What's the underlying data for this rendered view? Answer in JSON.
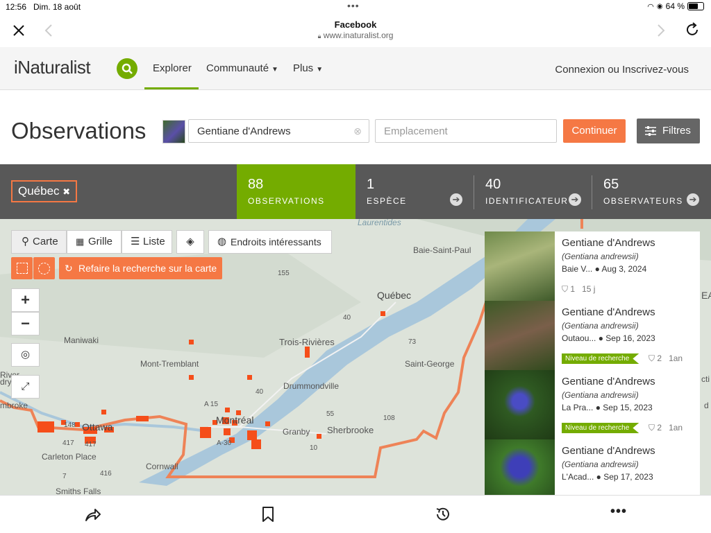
{
  "status": {
    "time": "12:56",
    "date": "Dim. 18 août",
    "battery": "64 %"
  },
  "browser": {
    "title": "Facebook",
    "url": "www.inaturalist.org"
  },
  "nav": {
    "logo": "iNaturalist",
    "items": [
      "Explorer",
      "Communauté",
      "Plus"
    ],
    "login": "Connexion ou Inscrivez-vous"
  },
  "header": {
    "title": "Observations",
    "taxon_value": "Gentiane d'Andrews",
    "place_placeholder": "Emplacement",
    "continue": "Continuer",
    "filters": "Filtres"
  },
  "stats": {
    "place": "Québec",
    "observations": {
      "num": "88",
      "label": "OBSERVATIONS"
    },
    "species": {
      "num": "1",
      "label": "ESPÈCE"
    },
    "identifiers": {
      "num": "40",
      "label": "IDENTIFICATEURS"
    },
    "observers": {
      "num": "65",
      "label": "OBSERVATEURS"
    }
  },
  "map": {
    "tabs": [
      "Carte",
      "Grille",
      "Liste"
    ],
    "places_btn": "Endroits intéressants",
    "redo_search": "Refaire la recherche sur la carte",
    "zoom_in": "+",
    "zoom_out": "−",
    "labels": {
      "laurentides": "Laurentides",
      "baie_st_paul": "Baie-Saint-Paul",
      "quebec": "Québec",
      "trois_rivieres": "Trois-Rivières",
      "maniwaki": "Maniwaki",
      "mont_tremblant": "Mont-Tremblant",
      "drummondville": "Drummondville",
      "saint_george": "Saint-George",
      "montreal": "Montréal",
      "granby": "Granby",
      "sherbrooke": "Sherbrooke",
      "ottawa": "Ottawa",
      "carleton_place": "Carleton Place",
      "cornwall": "Cornwall",
      "smiths_falls": "Smiths Falls",
      "river": "River",
      "dryde": "dryde",
      "mbroke": "mbroke",
      "ea": "EA",
      "cti": "cti",
      "d": "d"
    },
    "roads": [
      "155",
      "40",
      "73",
      "40",
      "A 15",
      "A-30",
      "55",
      "10",
      "108",
      "148",
      "417",
      "417",
      "416",
      "7"
    ]
  },
  "observations": [
    {
      "name": "Gentiane d'Andrews",
      "sci": "(Gentiana andrewsii)",
      "place": "Baie V...",
      "date": "Aug 3, 2024",
      "grade": "",
      "ids": "1",
      "age": "15 j"
    },
    {
      "name": "Gentiane d'Andrews",
      "sci": "(Gentiana andrewsii)",
      "place": "Outaou...",
      "date": "Sep 16, 2023",
      "grade": "Niveau de recherche",
      "ids": "2",
      "age": "1an"
    },
    {
      "name": "Gentiane d'Andrews",
      "sci": "(Gentiana andrewsii)",
      "place": "La Pra...",
      "date": "Sep 15, 2023",
      "grade": "Niveau de recherche",
      "ids": "2",
      "age": "1an"
    },
    {
      "name": "Gentiane d'Andrews",
      "sci": "(Gentiana andrewsii)",
      "place": "L'Acad...",
      "date": "Sep 17, 2023",
      "grade": "",
      "ids": "",
      "age": ""
    }
  ],
  "colors": {
    "green": "#74ac00",
    "orange": "#f57844",
    "statsbar": "#585858"
  }
}
